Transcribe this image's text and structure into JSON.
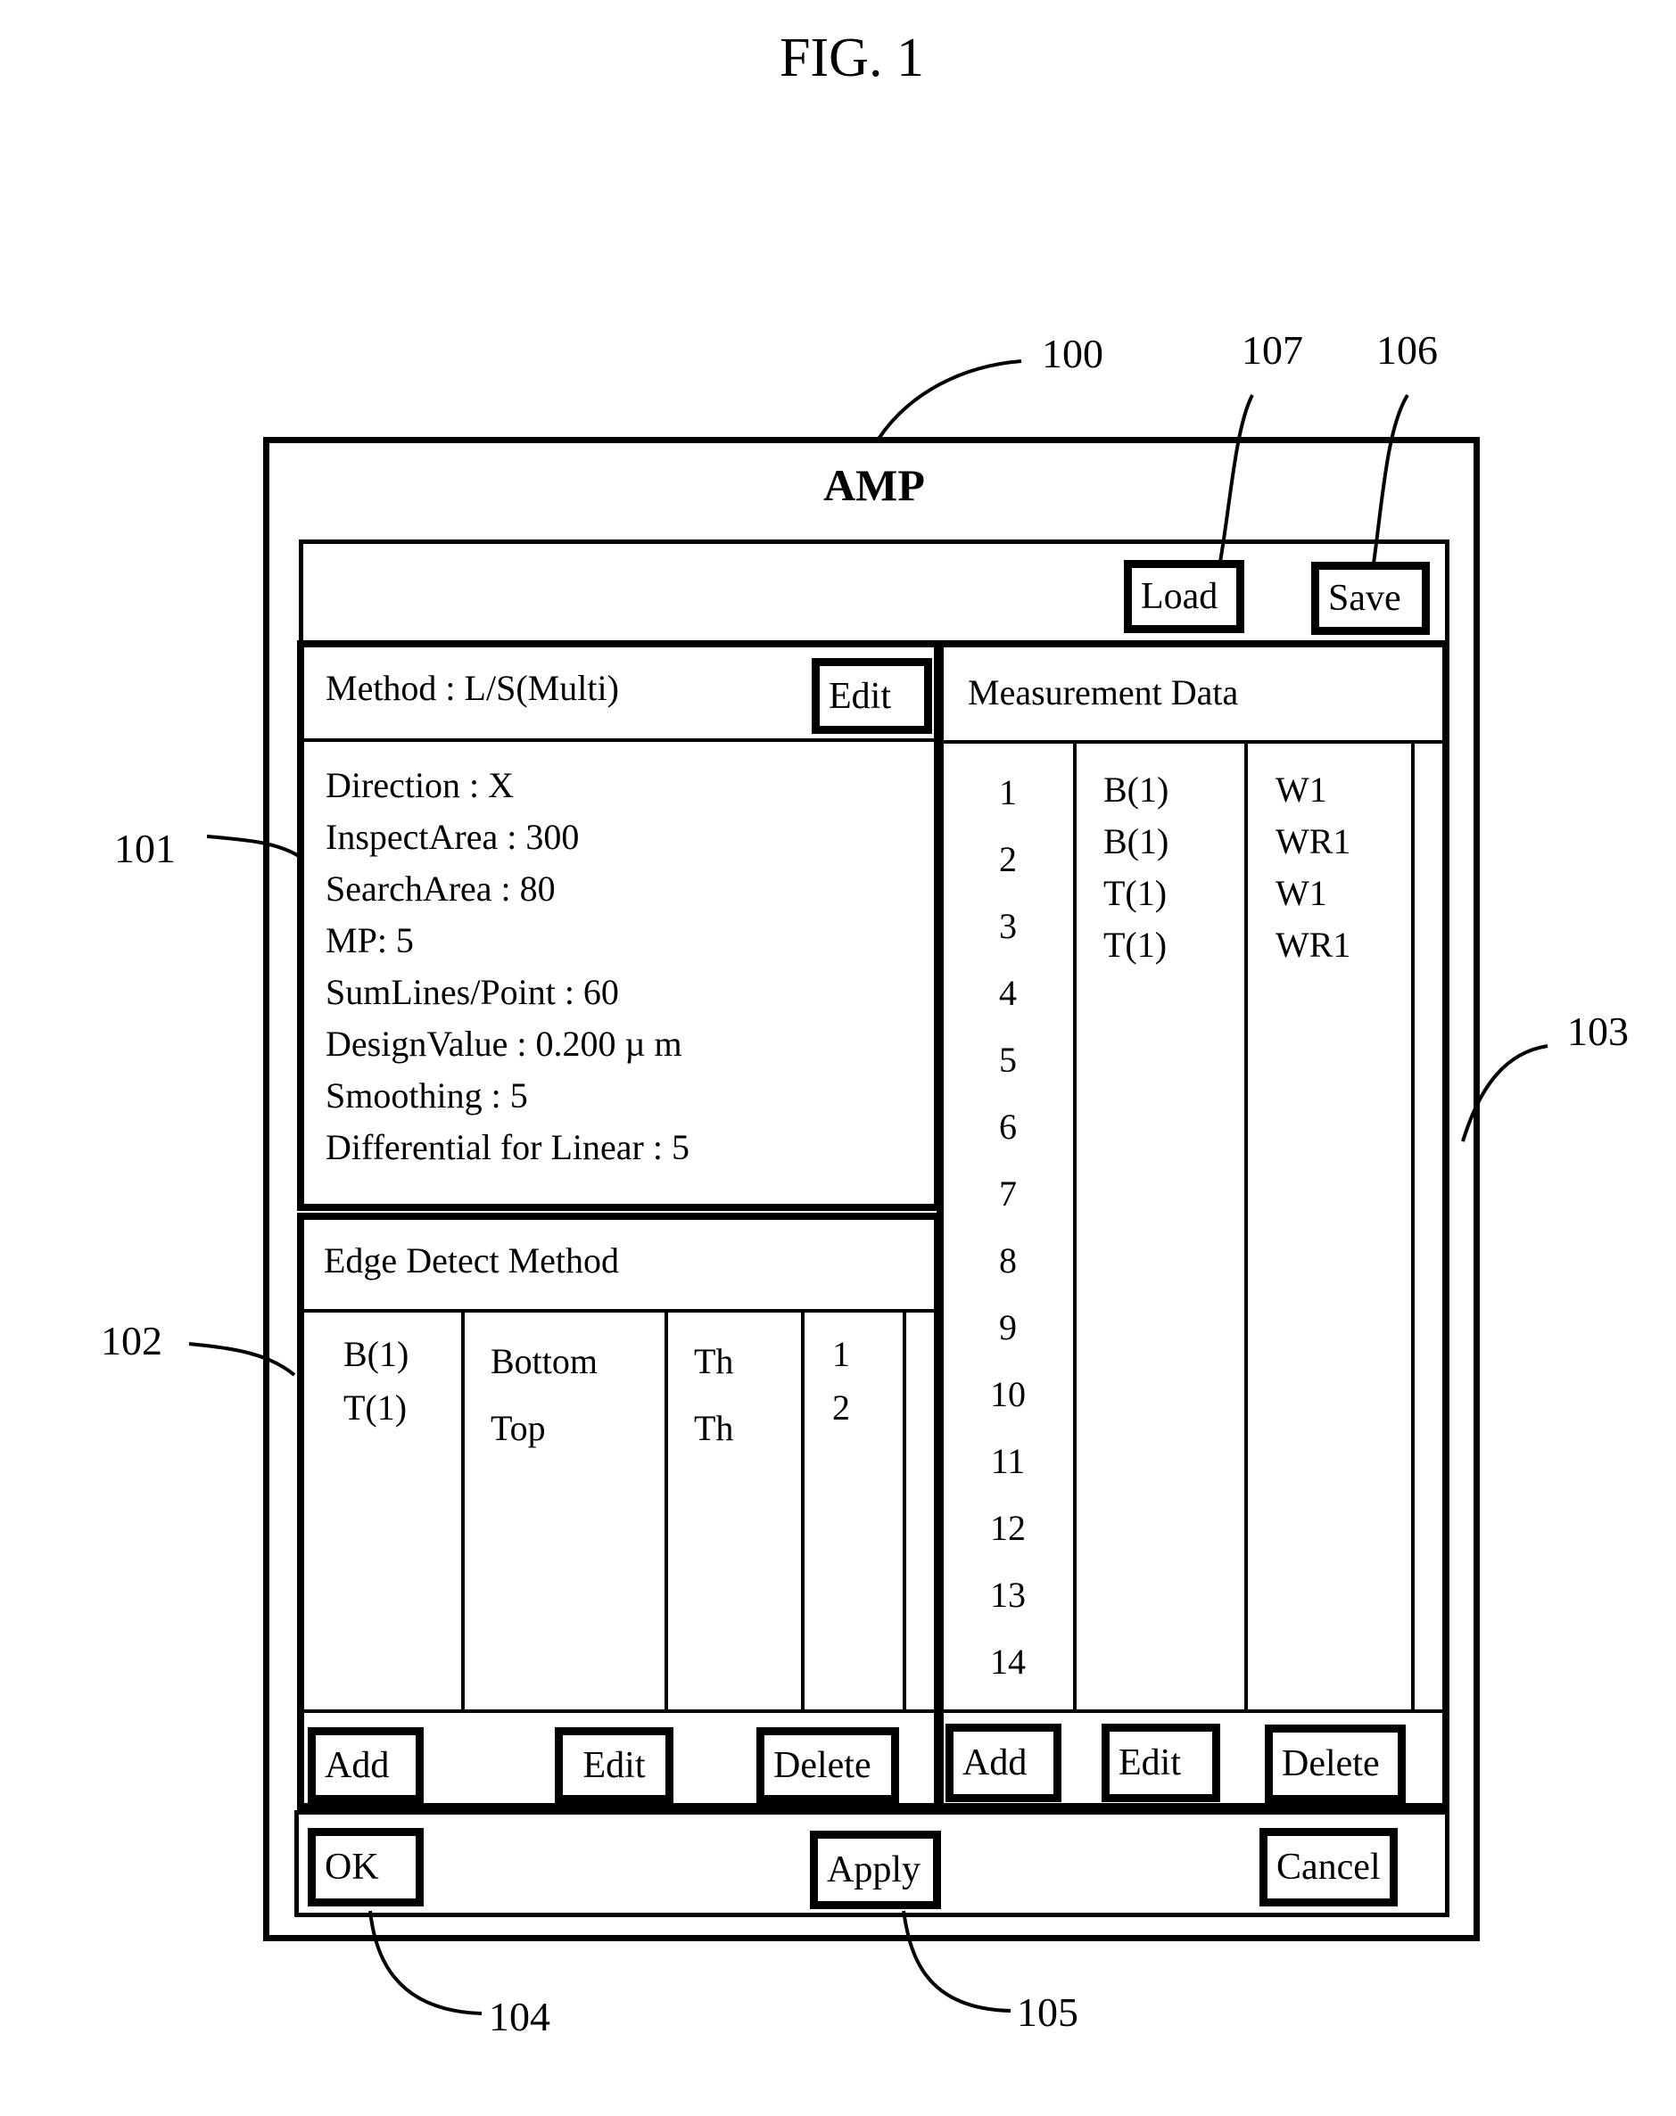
{
  "figure": {
    "title": "FIG. 1"
  },
  "callouts": {
    "window": "100",
    "load": "107",
    "save": "106",
    "method_panel": "101",
    "edge_panel": "102",
    "measurement_panel": "103",
    "ok": "104",
    "apply": "105"
  },
  "window": {
    "title": "AMP"
  },
  "toolbar": {
    "load_label": "Load",
    "save_label": "Save"
  },
  "method_panel": {
    "header": "Method : L/S(Multi)",
    "edit_label": "Edit",
    "params": [
      "Direction : X",
      "InspectArea : 300",
      "SearchArea : 80",
      "MP: 5",
      "SumLines/Point : 60",
      "DesignValue : 0.200 µ m",
      "Smoothing : 5",
      "Differential for Linear : 5"
    ]
  },
  "edge_panel": {
    "header": "Edge Detect Method",
    "rows": [
      {
        "id": "B(1)",
        "position": "Bottom",
        "method": "Th",
        "number": "1"
      },
      {
        "id": "T(1)",
        "position": "Top",
        "method": "Th",
        "number": "2"
      }
    ],
    "add_label": "Add",
    "edit_label": "Edit",
    "delete_label": "Delete"
  },
  "measurement_panel": {
    "header": "Measurement Data",
    "row_numbers": [
      "1",
      "2",
      "3",
      "4",
      "5",
      "6",
      "7",
      "8",
      "9",
      "10",
      "11",
      "12",
      "13",
      "14"
    ],
    "entries": [
      {
        "edge": "B(1)",
        "type": "W1"
      },
      {
        "edge": "B(1)",
        "type": "WR1"
      },
      {
        "edge": "T(1)",
        "type": "W1"
      },
      {
        "edge": "T(1)",
        "type": "WR1"
      }
    ],
    "add_label": "Add",
    "edit_label": "Edit",
    "delete_label": "Delete"
  },
  "footer": {
    "ok_label": "OK",
    "apply_label": "Apply",
    "cancel_label": "Cancel"
  }
}
